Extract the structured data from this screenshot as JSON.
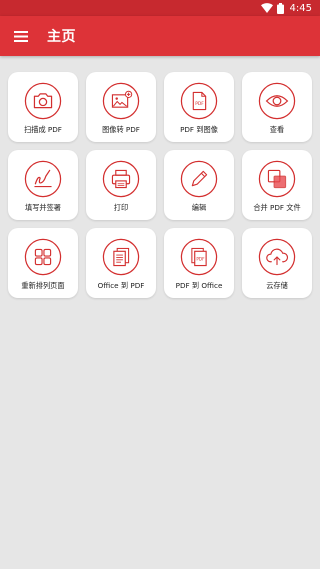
{
  "status_bar": {
    "time": "4:45",
    "icons": [
      "wifi-icon",
      "battery-icon"
    ]
  },
  "toolbar": {
    "title": "主页",
    "menu_icon": "hamburger-menu-icon"
  },
  "colors": {
    "primary": "#dd3338",
    "status": "#c7292f",
    "icon_red": "#d32f2f",
    "background": "#e6e6e6"
  },
  "tiles": [
    {
      "label": "扫描成 PDF",
      "icon": "camera-icon"
    },
    {
      "label": "图像转 PDF",
      "icon": "image-add-icon"
    },
    {
      "label": "PDF 到图像",
      "icon": "pdf-file-icon"
    },
    {
      "label": "查看",
      "icon": "eye-icon"
    },
    {
      "label": "填写并签署",
      "icon": "signature-icon"
    },
    {
      "label": "打印",
      "icon": "printer-icon"
    },
    {
      "label": "编辑",
      "icon": "pencil-icon"
    },
    {
      "label": "合并 PDF 文件",
      "icon": "merge-icon"
    },
    {
      "label": "重新排列页面",
      "icon": "grid-icon"
    },
    {
      "label": "Office 到 PDF",
      "icon": "document-icon"
    },
    {
      "label": "PDF 到 Office",
      "icon": "pdf-stack-icon"
    },
    {
      "label": "云存储",
      "icon": "cloud-upload-icon"
    }
  ]
}
